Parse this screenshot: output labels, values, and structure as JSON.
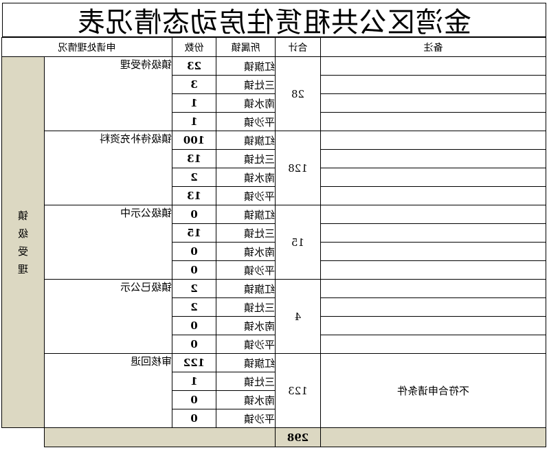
{
  "title": "金湾区公共租赁住房动态情况表",
  "headers": {
    "remark": "备注",
    "subtotal": "合计",
    "town": "所属镇",
    "count": "份数",
    "status": "申请处理情况"
  },
  "stage_label": "镇级受理",
  "groups": [
    {
      "status": "镇级待受理",
      "subtotal": "28",
      "remark": "",
      "rows": [
        {
          "town": "红旗镇",
          "count": "23"
        },
        {
          "town": "三灶镇",
          "count": "3"
        },
        {
          "town": "南水镇",
          "count": "1"
        },
        {
          "town": "平沙镇",
          "count": "1"
        }
      ]
    },
    {
      "status": "镇级待补充资料",
      "subtotal": "128",
      "remark": "",
      "rows": [
        {
          "town": "红旗镇",
          "count": "100"
        },
        {
          "town": "三灶镇",
          "count": "13"
        },
        {
          "town": "南水镇",
          "count": "2"
        },
        {
          "town": "平沙镇",
          "count": "13"
        }
      ]
    },
    {
      "status": "镇级公示中",
      "subtotal": "15",
      "remark": "",
      "rows": [
        {
          "town": "红旗镇",
          "count": "0"
        },
        {
          "town": "三灶镇",
          "count": "15"
        },
        {
          "town": "南水镇",
          "count": "0"
        },
        {
          "town": "平沙镇",
          "count": "0"
        }
      ]
    },
    {
      "status": "镇级已公示",
      "subtotal": "4",
      "remark": "",
      "rows": [
        {
          "town": "红旗镇",
          "count": "2"
        },
        {
          "town": "三灶镇",
          "count": "2"
        },
        {
          "town": "南水镇",
          "count": "0"
        },
        {
          "town": "平沙镇",
          "count": "0"
        }
      ]
    },
    {
      "status": "审核回退",
      "subtotal": "123",
      "remark": "不符合申请条件",
      "rows": [
        {
          "town": "红旗镇",
          "count": "122"
        },
        {
          "town": "三灶镇",
          "count": "1"
        },
        {
          "town": "南水镇",
          "count": "0"
        },
        {
          "town": "平沙镇",
          "count": "0"
        }
      ]
    }
  ],
  "total": "298",
  "colors": {
    "stage_fill": "#dcd8c2",
    "border": "#000000"
  }
}
